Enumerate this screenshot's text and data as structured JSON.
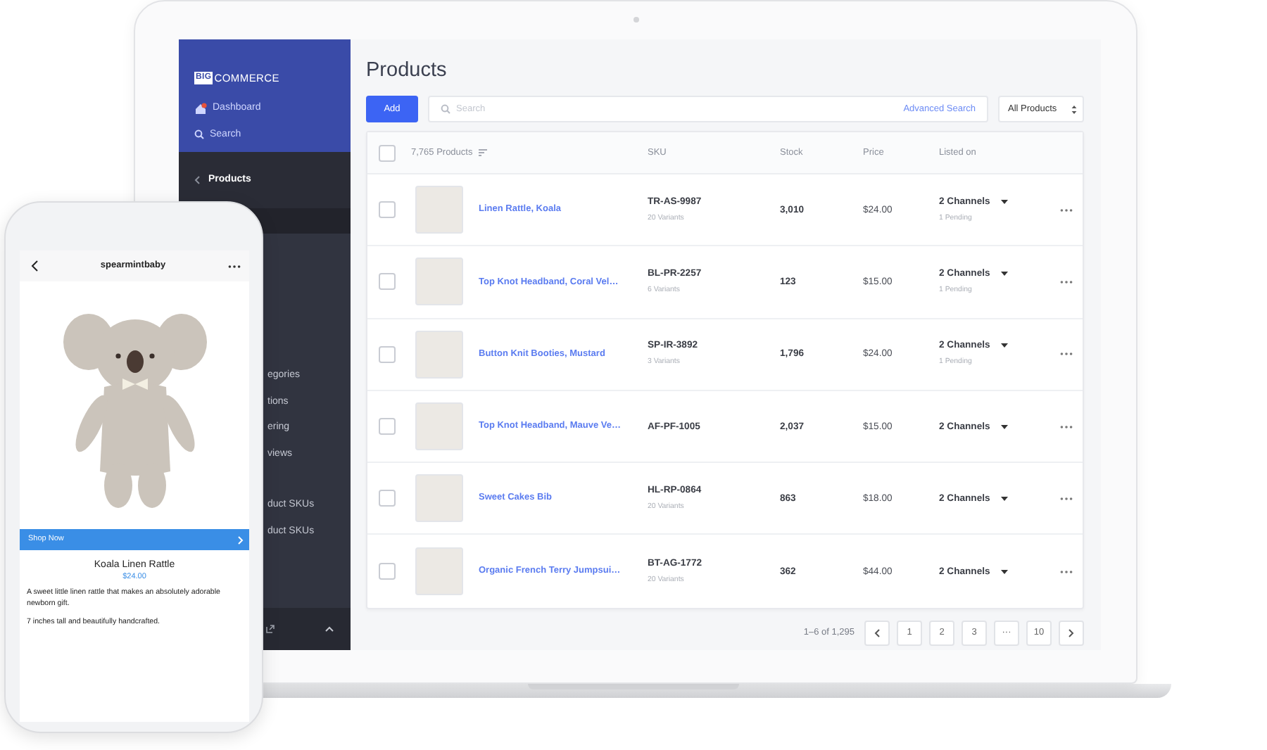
{
  "sidebar": {
    "logo_prefix": "BIG",
    "logo_name": "COMMERCE",
    "top_links": [
      {
        "label": "Dashboard"
      },
      {
        "label": "Search"
      }
    ],
    "section": {
      "label": "Products"
    },
    "sub_groups": [
      [
        {
          "label": "egories"
        },
        {
          "label": "tions"
        },
        {
          "label": "ering"
        },
        {
          "label": "views"
        }
      ],
      [
        {
          "label": "duct SKUs"
        },
        {
          "label": "duct SKUs"
        }
      ]
    ]
  },
  "main": {
    "page_title": "Products",
    "add_button": "Add",
    "search": {
      "placeholder": "Search",
      "link": "Advanced Search"
    },
    "filter": "All Products",
    "table": {
      "select_all_checked": false,
      "columns": [
        "7,765 Products",
        "SKU",
        "Stock",
        "Price",
        "Listed on"
      ],
      "rows": [
        {
          "name": "Linen Rattle, Koala",
          "sku": "TR-AS-9987",
          "variants": "20 Variants",
          "stock": "3,010",
          "price": "$24.00",
          "channels": "2 Channels",
          "pending": "1 Pending",
          "checked": false
        },
        {
          "name": "Top Knot Headband, Coral Vel…",
          "sku": "BL-PR-2257",
          "variants": "6 Variants",
          "stock": "123",
          "price": "$15.00",
          "channels": "2 Channels",
          "pending": "1 Pending",
          "checked": false
        },
        {
          "name": "Button Knit Booties, Mustard",
          "sku": "SP-IR-3892",
          "variants": "3 Variants",
          "stock": "1,796",
          "price": "$24.00",
          "channels": "2 Channels",
          "pending": "1 Pending",
          "checked": false
        },
        {
          "name": "Top Knot Headband, Mauve Ve…",
          "sku": "AF-PF-1005",
          "stock": "2,037",
          "price": "$15.00",
          "channels": "2 Channels",
          "checked": false
        },
        {
          "name": "Sweet Cakes Bib",
          "sku": "HL-RP-0864",
          "variants": "20 Variants",
          "stock": "863",
          "price": "$18.00",
          "channels": "2 Channels",
          "checked": false
        },
        {
          "name": "Organic French Terry Jumpsui…",
          "sku": "BT-AG-1772",
          "variants": "20 Variants",
          "stock": "362",
          "price": "$44.00",
          "channels": "2 Channels",
          "checked": false
        }
      ]
    },
    "pagination": {
      "summary": "1–6 of 1,295",
      "pages": [
        "1",
        "2",
        "3",
        "···",
        "10"
      ]
    }
  },
  "phone": {
    "title": "spearmintbaby",
    "cta": "Shop Now",
    "product": "Koala Linen Rattle",
    "price": "$24.00",
    "description": [
      "A sweet little linen rattle that makes an absolutely adorable newborn gift.",
      "7 inches tall and beautifully handcrafted."
    ]
  }
}
